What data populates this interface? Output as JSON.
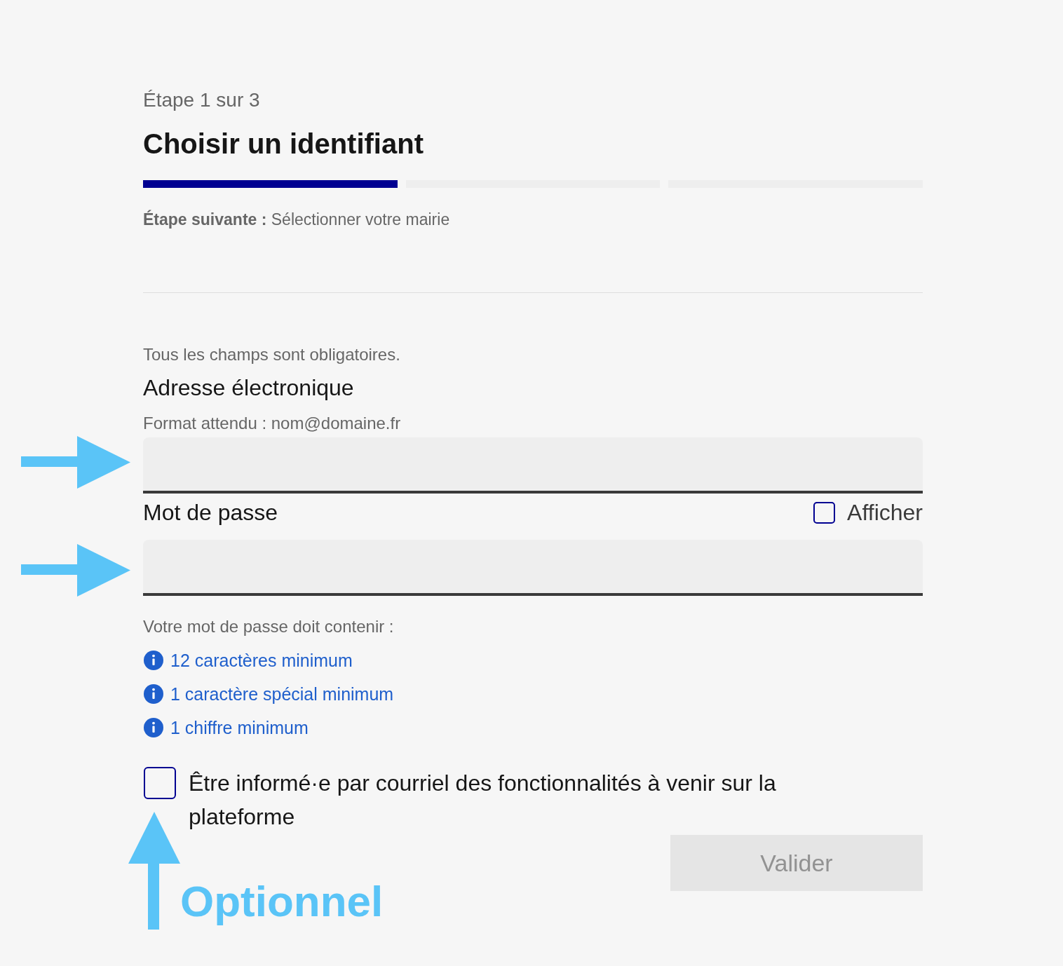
{
  "stepper": {
    "step_label": "Étape 1 sur 3",
    "title": "Choisir un identifiant",
    "segments": [
      {
        "filled": true
      },
      {
        "filled": false
      },
      {
        "filled": false
      }
    ],
    "next_step": "**Étape suivante :** Sélectionner votre mairie"
  },
  "form": {
    "required_note": "Tous les champs sont obligatoires.",
    "fields": [
      {
        "label": "Adresse électronique",
        "description": "Format attendu : nom@domaine.fr"
      },
      {
        "label": "Mot de passe",
        "show_toggle": {
          "label": "Afficher",
          "checked": false
        }
      }
    ],
    "password_rules": {
      "intro": "Votre mot de passe doit contenir :",
      "items": [
        "12 caractères minimum",
        "1 caractère spécial minimum",
        "1 chiffre minimum"
      ]
    },
    "newsletter": {
      "label": "Être informé·e par courriel des fonctionnalités à venir sur la plateforme",
      "checked": false
    },
    "submit": {
      "label": "Valider",
      "disabled": true
    }
  },
  "annotation": {
    "label": "Optionnel"
  }
}
